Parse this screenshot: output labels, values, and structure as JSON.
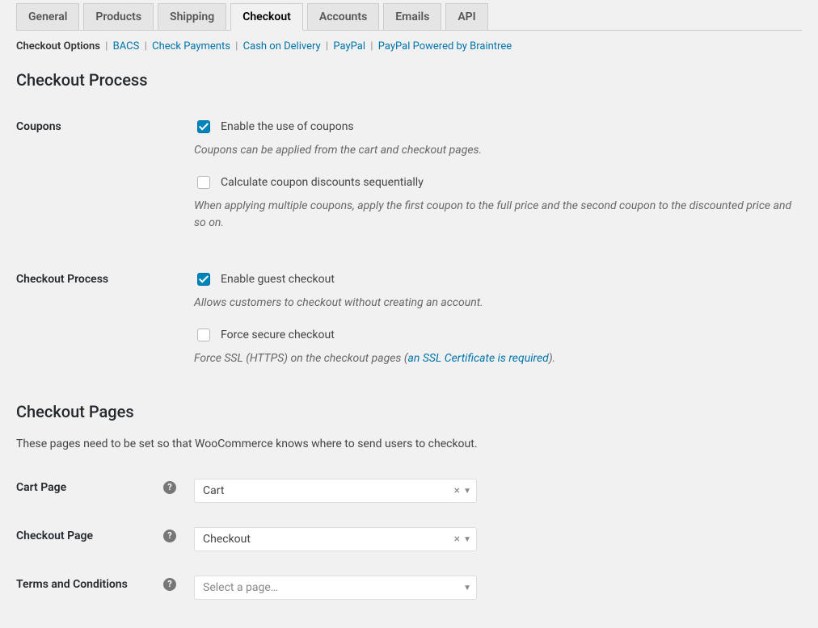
{
  "tabs": [
    "General",
    "Products",
    "Shipping",
    "Checkout",
    "Accounts",
    "Emails",
    "API"
  ],
  "activeTab": "Checkout",
  "subnav": {
    "current": "Checkout Options",
    "links": [
      "BACS",
      "Check Payments",
      "Cash on Delivery",
      "PayPal",
      "PayPal Powered by Braintree"
    ]
  },
  "sections": {
    "process": {
      "heading": "Checkout Process",
      "coupons": {
        "label": "Coupons",
        "enable": {
          "text": "Enable the use of coupons",
          "checked": true
        },
        "enable_desc": "Coupons can be applied from the cart and checkout pages.",
        "sequential": {
          "text": "Calculate coupon discounts sequentially",
          "checked": false
        },
        "sequential_desc": "When applying multiple coupons, apply the first coupon to the full price and the second coupon to the discounted price and so on."
      },
      "checkout": {
        "label": "Checkout Process",
        "guest": {
          "text": "Enable guest checkout",
          "checked": true
        },
        "guest_desc": "Allows customers to checkout without creating an account.",
        "secure": {
          "text": "Force secure checkout",
          "checked": false
        },
        "secure_desc_a": "Force SSL (HTTPS) on the checkout pages (",
        "secure_link": "an SSL Certificate is required",
        "secure_desc_b": ")."
      }
    },
    "pages": {
      "heading": "Checkout Pages",
      "desc": "These pages need to be set so that WooCommerce knows where to send users to checkout.",
      "cart": {
        "label": "Cart Page",
        "value": "Cart"
      },
      "checkout": {
        "label": "Checkout Page",
        "value": "Checkout"
      },
      "terms": {
        "label": "Terms and Conditions",
        "placeholder": "Select a page…"
      }
    }
  }
}
